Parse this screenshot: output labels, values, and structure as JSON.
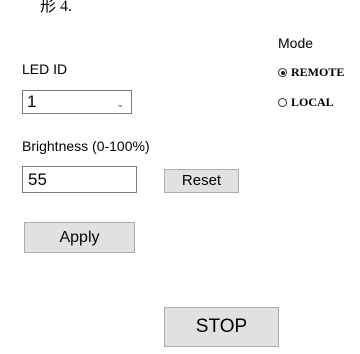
{
  "top_cut_text": "形 4.",
  "mode": {
    "label": "Mode",
    "options": [
      "REMOTE",
      "LOCAL"
    ],
    "selected": "REMOTE"
  },
  "led": {
    "label": "LED ID",
    "value": "1"
  },
  "brightness": {
    "label": "Brightness (0-100%)",
    "value": "55"
  },
  "buttons": {
    "reset": "Reset",
    "apply": "Apply",
    "stop": "STOP"
  }
}
